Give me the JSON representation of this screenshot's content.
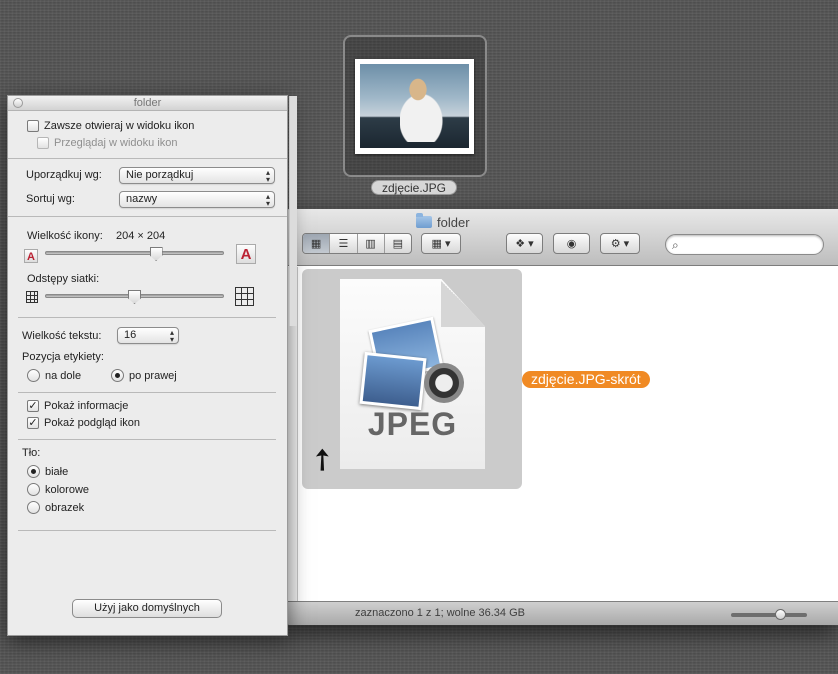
{
  "desktop_item": {
    "label": "zdjęcie.JPG"
  },
  "finder": {
    "title": "folder",
    "view_modes": [
      "icons",
      "list",
      "columns",
      "cover-flow"
    ],
    "search": {
      "placeholder": ""
    },
    "file": {
      "label": "zdjęcie.JPG-skrót",
      "doc_type": "JPEG"
    },
    "status": "zaznaczono 1 z 1; wolne 36.34 GB",
    "accent": "#f08a24"
  },
  "panel": {
    "title": "folder",
    "always_open_icon_view": "Zawsze otwieraj w widoku ikon",
    "browse_icon_view": "Przeglądaj w widoku ikon",
    "arrange_by_label": "Uporządkuj wg:",
    "arrange_by_value": "Nie porządkuj",
    "sort_by_label": "Sortuj wg:",
    "sort_by_value": "nazwy",
    "icon_size_label": "Wielkość ikony:",
    "icon_size_value": "204 × 204",
    "icon_size_fraction": 0.63,
    "grid_spacing_label": "Odstępy siatki:",
    "grid_spacing_fraction": 0.5,
    "text_size_label": "Wielkość tekstu:",
    "text_size_value": "16",
    "label_position_label": "Pozycja etykiety:",
    "label_bottom": "na dole",
    "label_right": "po prawej",
    "label_position_selected": "po prawej",
    "show_info": "Pokaż informacje",
    "show_preview": "Pokaż podgląd ikon",
    "background_label": "Tło:",
    "bg_white": "białe",
    "bg_color": "kolorowe",
    "bg_picture": "obrazek",
    "background_selected": "białe",
    "use_defaults": "Użyj jako domyślnych"
  }
}
